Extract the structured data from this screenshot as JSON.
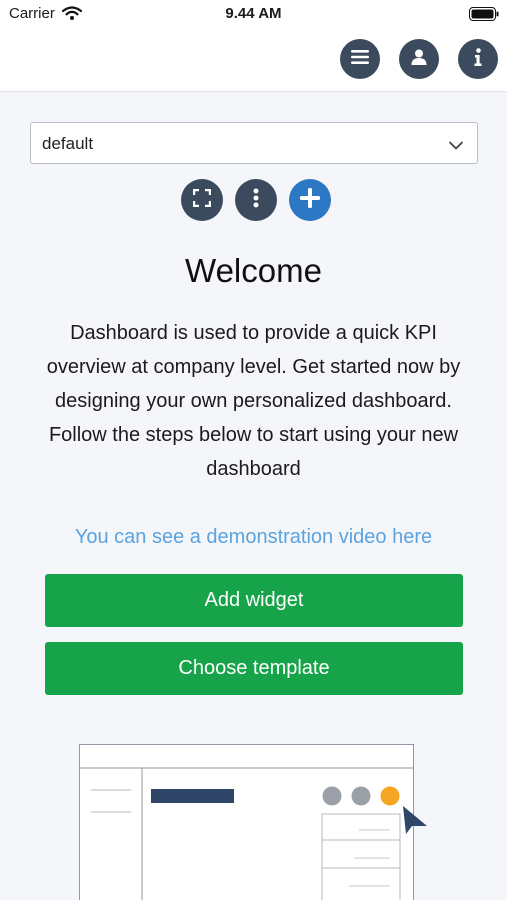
{
  "status_bar": {
    "carrier": "Carrier",
    "time": "9.44 AM"
  },
  "header": {
    "icons": [
      "menu-icon",
      "user-icon",
      "info-icon"
    ]
  },
  "dashboard_select": {
    "value": "default"
  },
  "toolbar": {
    "icons": [
      "fullscreen-icon",
      "more-vertical-icon",
      "add-icon"
    ]
  },
  "welcome": {
    "title": "Welcome",
    "intro": "Dashboard is used to provide a quick KPI overview at company level. Get started now by designing your own personalized dashboard.",
    "steps": "Follow the steps below to start using your new dashboard",
    "demo_link": "You can see a demonstration video here"
  },
  "actions": {
    "add_widget": "Add widget",
    "choose_template": "Choose template"
  },
  "colors": {
    "accent_dark": "#3b4a5c",
    "accent_blue": "#2d78c4",
    "primary_green": "#17a349",
    "link_blue": "#5ba3e0",
    "highlight_orange": "#f5a623"
  }
}
